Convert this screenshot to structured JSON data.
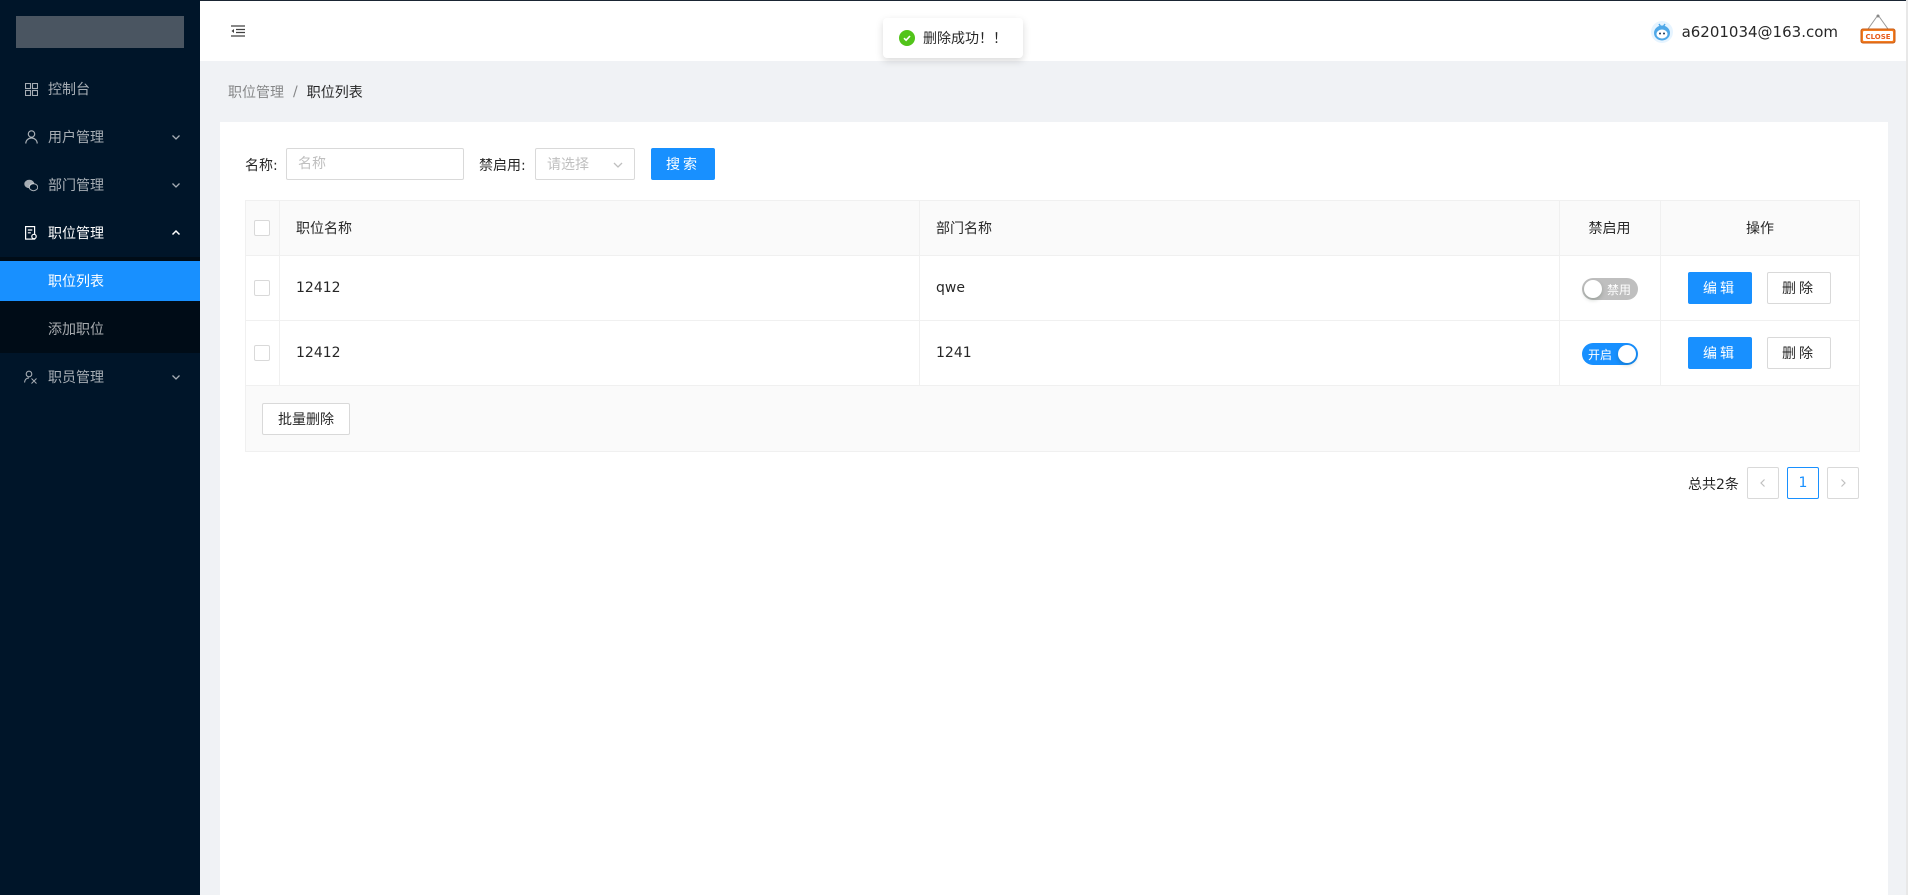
{
  "sidebar": {
    "items": [
      {
        "label": "控制台",
        "icon": "dashboard-icon"
      },
      {
        "label": "用户管理",
        "icon": "user-icon"
      },
      {
        "label": "部门管理",
        "icon": "wechat-icon"
      },
      {
        "label": "职位管理",
        "icon": "solution-icon"
      },
      {
        "label": "职员管理",
        "icon": "usergroup-icon"
      }
    ],
    "sub_items": [
      {
        "label": "职位列表"
      },
      {
        "label": "添加职位"
      }
    ]
  },
  "header": {
    "user_email": "a6201034@163.com",
    "close_text": "CLOSE"
  },
  "toast": {
    "message": "删除成功！！"
  },
  "breadcrumb": {
    "parent": "职位管理",
    "separator": "/",
    "current": "职位列表"
  },
  "filter": {
    "name_label": "名称:",
    "name_placeholder": "名称",
    "status_label": "禁启用:",
    "status_placeholder": "请选择",
    "search_label": "搜索"
  },
  "table": {
    "columns": [
      "职位名称",
      "部门名称",
      "禁启用",
      "操作"
    ],
    "rows": [
      {
        "position_name": "12412",
        "department_name": "qwe",
        "enabled": false,
        "switch_label": "禁用"
      },
      {
        "position_name": "12412",
        "department_name": "1241",
        "enabled": true,
        "switch_label": "开启"
      }
    ],
    "edit_label": "编辑",
    "delete_label": "删除",
    "batch_delete_label": "批量删除"
  },
  "pagination": {
    "total_text": "总共2条",
    "current_page": "1"
  },
  "colors": {
    "primary": "#1890ff",
    "sidebar_bg": "#001529",
    "success": "#52c41a"
  }
}
